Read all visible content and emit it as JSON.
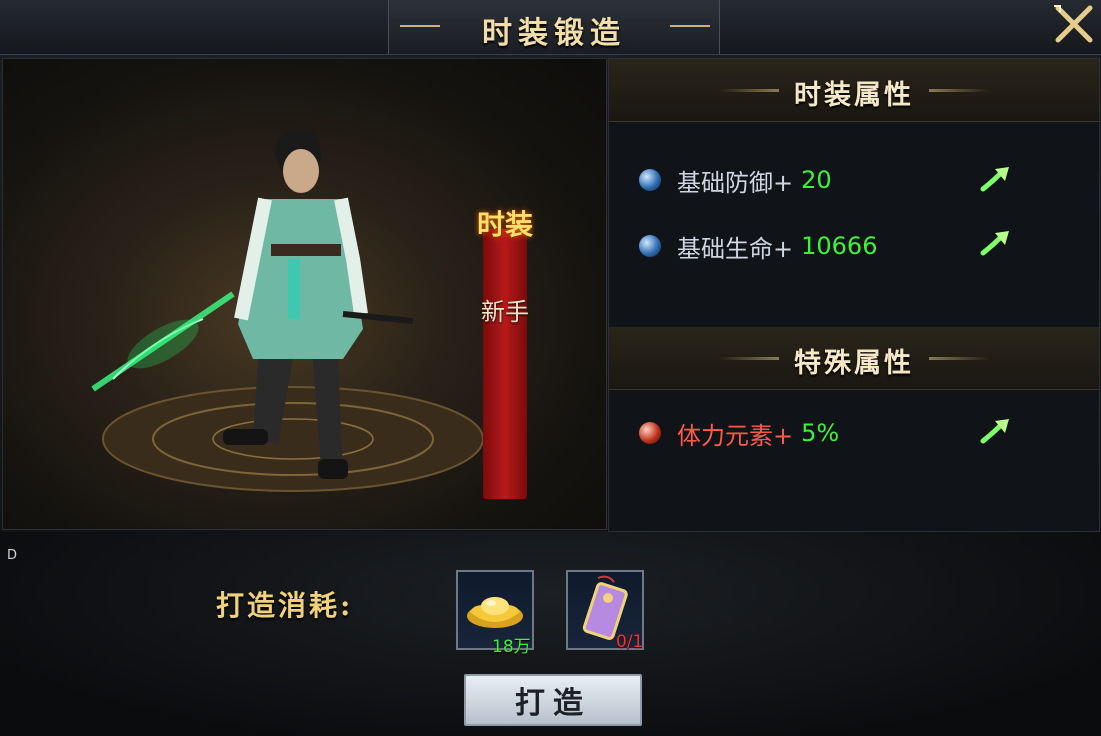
{
  "title": "时装锻造",
  "scene": {
    "banner_top": "时装",
    "banner_sub": "新手"
  },
  "fashion_attrs": {
    "header": "时装属性",
    "items": [
      {
        "label": "基础防御+",
        "value": "20"
      },
      {
        "label": "基础生命+",
        "value": "10666"
      }
    ]
  },
  "special_attrs": {
    "header": "特殊属性",
    "items": [
      {
        "label": "体力元素+",
        "value": "5%"
      }
    ]
  },
  "cost": {
    "label": "打造消耗:",
    "items": [
      {
        "name": "gold-ingot",
        "qty": "18万",
        "qty_color": "#3df23a"
      },
      {
        "name": "forging-token",
        "qty": "0/1",
        "qty_color": "#ff2a2a"
      }
    ]
  },
  "forge_button": "打造",
  "side_label": "D"
}
